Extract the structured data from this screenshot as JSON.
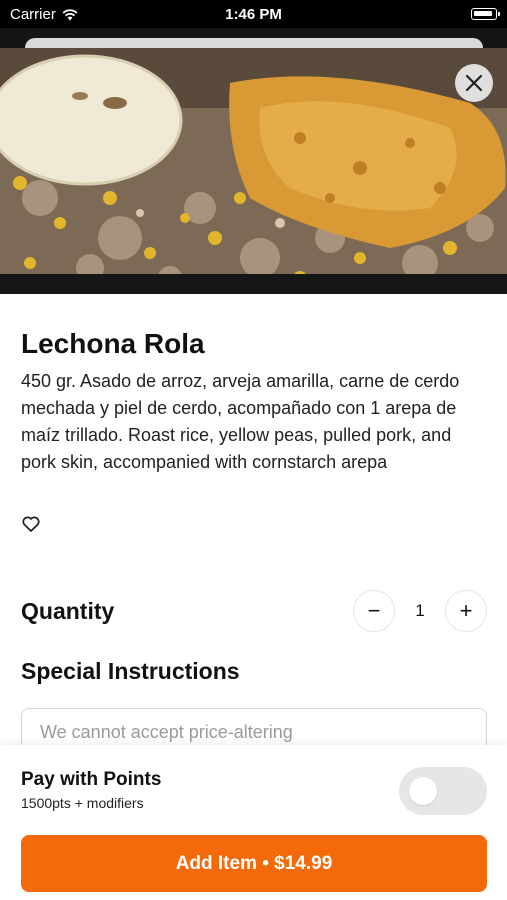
{
  "status_bar": {
    "carrier": "Carrier",
    "time": "1:46 PM"
  },
  "item": {
    "title": "Lechona Rola",
    "description": "450 gr. Asado de arroz, arveja amarilla, carne de cerdo mechada y piel de cerdo, acompañado con 1 arepa de maíz trillado.  Roast rice, yellow peas, pulled pork, and pork skin, accompanied with cornstarch arepa"
  },
  "quantity": {
    "label": "Quantity",
    "value": "1",
    "minus": "−",
    "plus": "+"
  },
  "special_instructions": {
    "label": "Special Instructions",
    "placeholder": "We cannot accept price-altering"
  },
  "points": {
    "title": "Pay with Points",
    "subtitle": "1500pts + modifiers",
    "enabled": false
  },
  "add_button": {
    "label": "Add Item • $14.99"
  },
  "icons": {
    "close": "close-icon",
    "favorite": "heart-outline-icon",
    "wifi": "wifi-icon",
    "battery": "battery-icon"
  },
  "colors": {
    "accent": "#f46a0b",
    "toggle_off": "#e6e6e6"
  }
}
